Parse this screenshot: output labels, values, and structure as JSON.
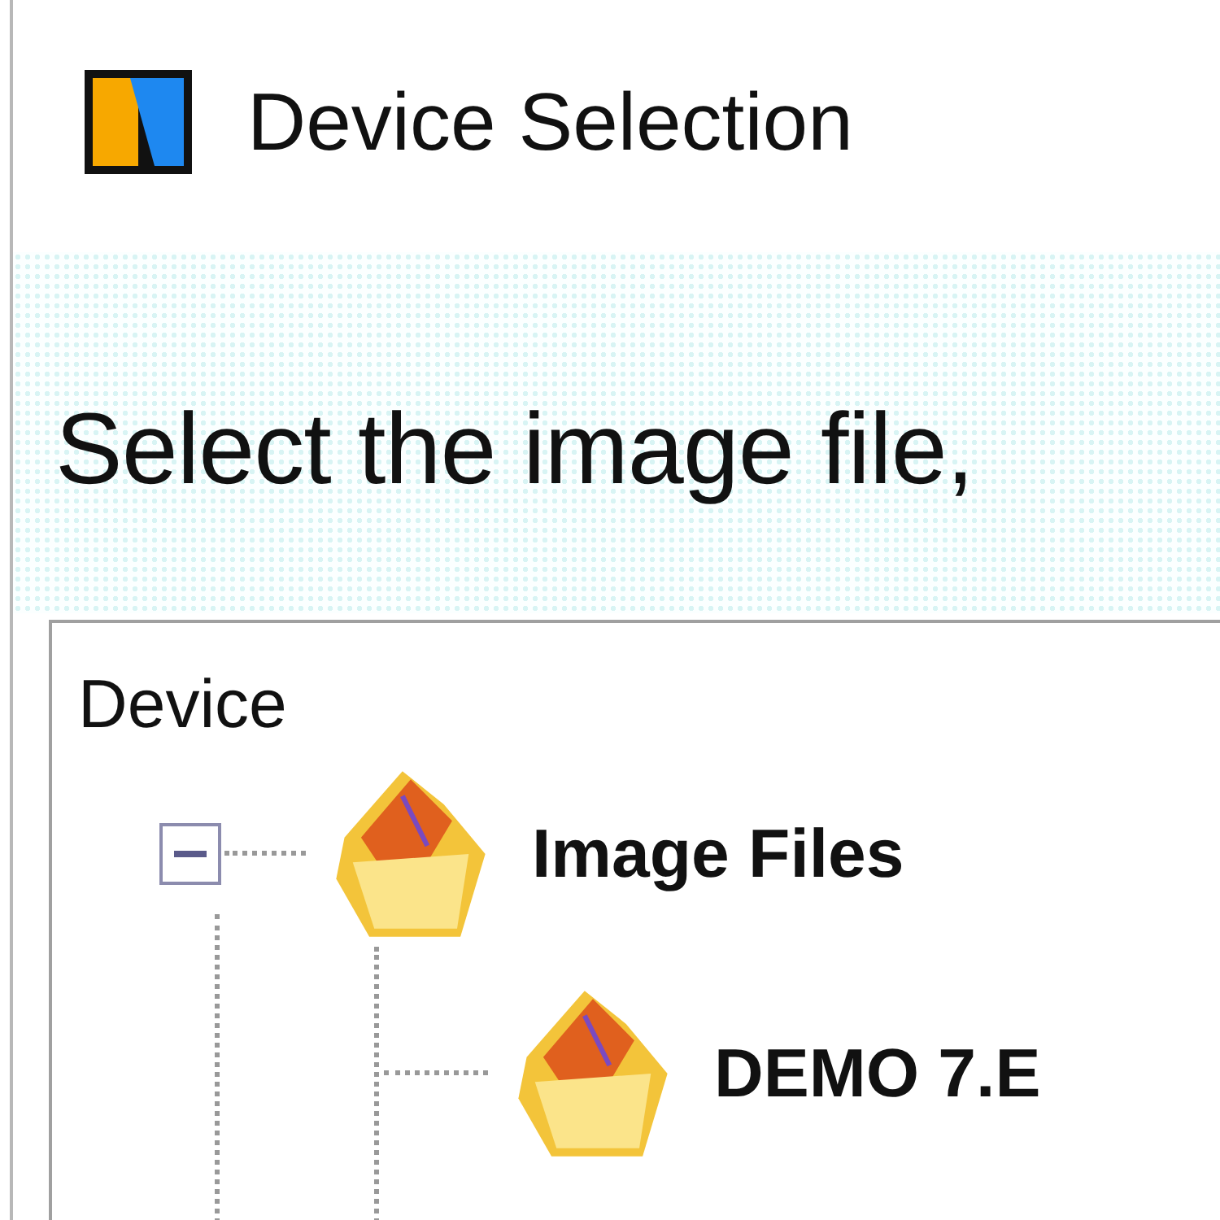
{
  "window": {
    "title": "Device Selection"
  },
  "instruction": "Select the image file,",
  "tree": {
    "header": "Device",
    "items": [
      {
        "label": "Image Files",
        "expanded": true,
        "children": [
          {
            "label": "DEMO 7.E"
          }
        ]
      }
    ]
  }
}
